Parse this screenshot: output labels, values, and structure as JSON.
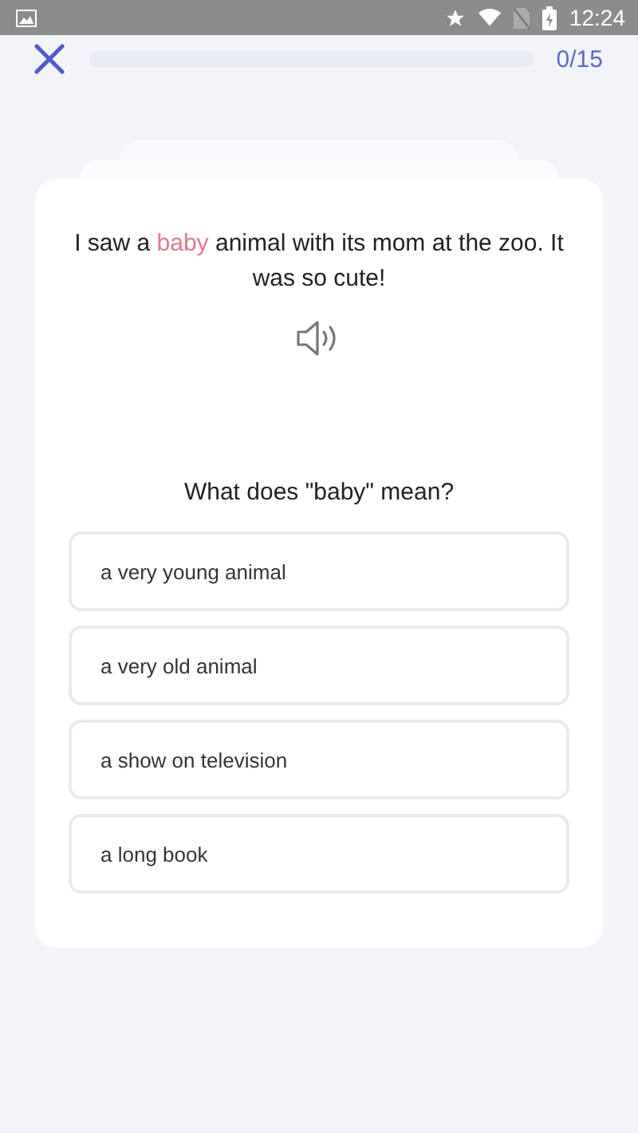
{
  "status_bar": {
    "time": "12:24"
  },
  "header": {
    "progress": {
      "level": 0
    },
    "counter": "0/15"
  },
  "sentence": [
    {
      "text": "I saw a ",
      "highlight": false
    },
    {
      "text": "baby",
      "highlight": true
    },
    {
      "text": " animal with its mom at the zoo. It was so cute!",
      "highlight": false
    }
  ],
  "question": "What does \"baby\" mean?",
  "options": [
    {
      "label": "a very young animal",
      "selected": false
    },
    {
      "label": "a very old animal",
      "selected": false
    },
    {
      "label": "a show on television",
      "selected": false
    },
    {
      "label": "a long book",
      "selected": false
    }
  ]
}
